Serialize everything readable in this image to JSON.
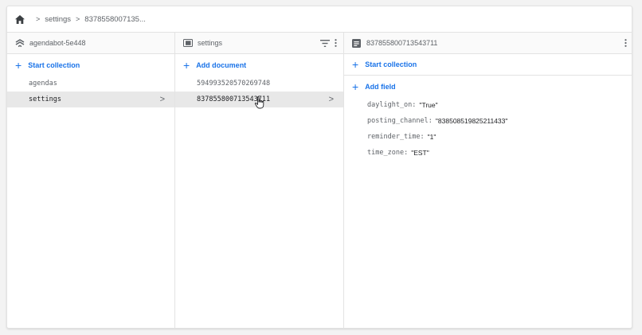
{
  "breadcrumb": {
    "items": [
      "settings",
      "8378558007135..."
    ]
  },
  "panels": {
    "project": {
      "title": "agendabot-5e448",
      "add_label": "Start collection",
      "items": [
        {
          "label": "agendas"
        },
        {
          "label": "settings"
        }
      ]
    },
    "collection": {
      "title": "settings",
      "add_label": "Add document",
      "items": [
        {
          "label": "594993520570269748"
        },
        {
          "label": "837855800713543711"
        }
      ]
    },
    "document": {
      "title": "837855800713543711",
      "add_collection_label": "Start collection",
      "add_field_label": "Add field",
      "fields": [
        {
          "key": "daylight_on",
          "value": "\"True\""
        },
        {
          "key": "posting_channel",
          "value": "\"838508519825211433\""
        },
        {
          "key": "reminder_time",
          "value": "\"1\""
        },
        {
          "key": "time_zone",
          "value": "\"EST\""
        }
      ]
    }
  },
  "colors": {
    "accent": "#1a73e8",
    "selected_row": "#e8e8e8",
    "text_muted": "#5f6368"
  },
  "icons": {
    "home": "home-icon",
    "project": "firestore-project-icon",
    "collection": "collection-icon",
    "document": "document-icon",
    "filter": "filter-icon",
    "more": "more-vert-icon",
    "chevron": "chevron-right-icon",
    "cursor": "hand-pointer-icon"
  }
}
